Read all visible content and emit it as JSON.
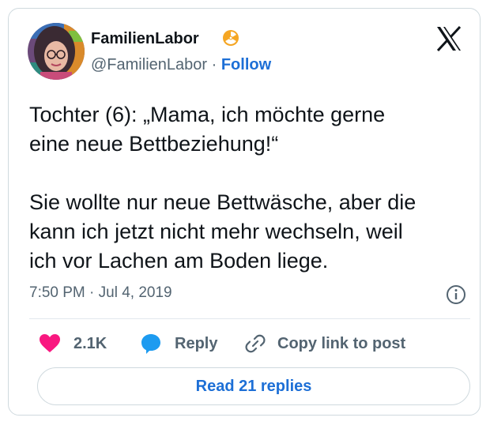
{
  "author": {
    "display_name": "FamilienLabor",
    "handle": "@FamilienLabor",
    "separator": "·",
    "follow_label": "Follow",
    "badge_icon": "radioactive-icon",
    "badge_color": "#f5a623"
  },
  "platform": {
    "logo_icon": "x-logo-icon"
  },
  "tweet": {
    "text": "Tochter (6): „Mama, ich möchte gerne\neine neue Bettbeziehung!“\n\nSie wollte nur neue Bettwäsche, aber die\nkann ich jetzt nicht mehr wechseln, weil\nich vor Lachen am Boden liege.",
    "timestamp": "7:50 PM · Jul 4, 2019"
  },
  "actions": {
    "like_count": "2.1K",
    "like_color": "#f91880",
    "reply_label": "Reply",
    "reply_color": "#1d9bf0",
    "copy_label": "Copy link to post"
  },
  "footer": {
    "read_replies_label": "Read 21 replies"
  },
  "colors": {
    "link_blue": "#1d6fd6",
    "muted_text": "#536471",
    "border": "#cfd9de"
  }
}
